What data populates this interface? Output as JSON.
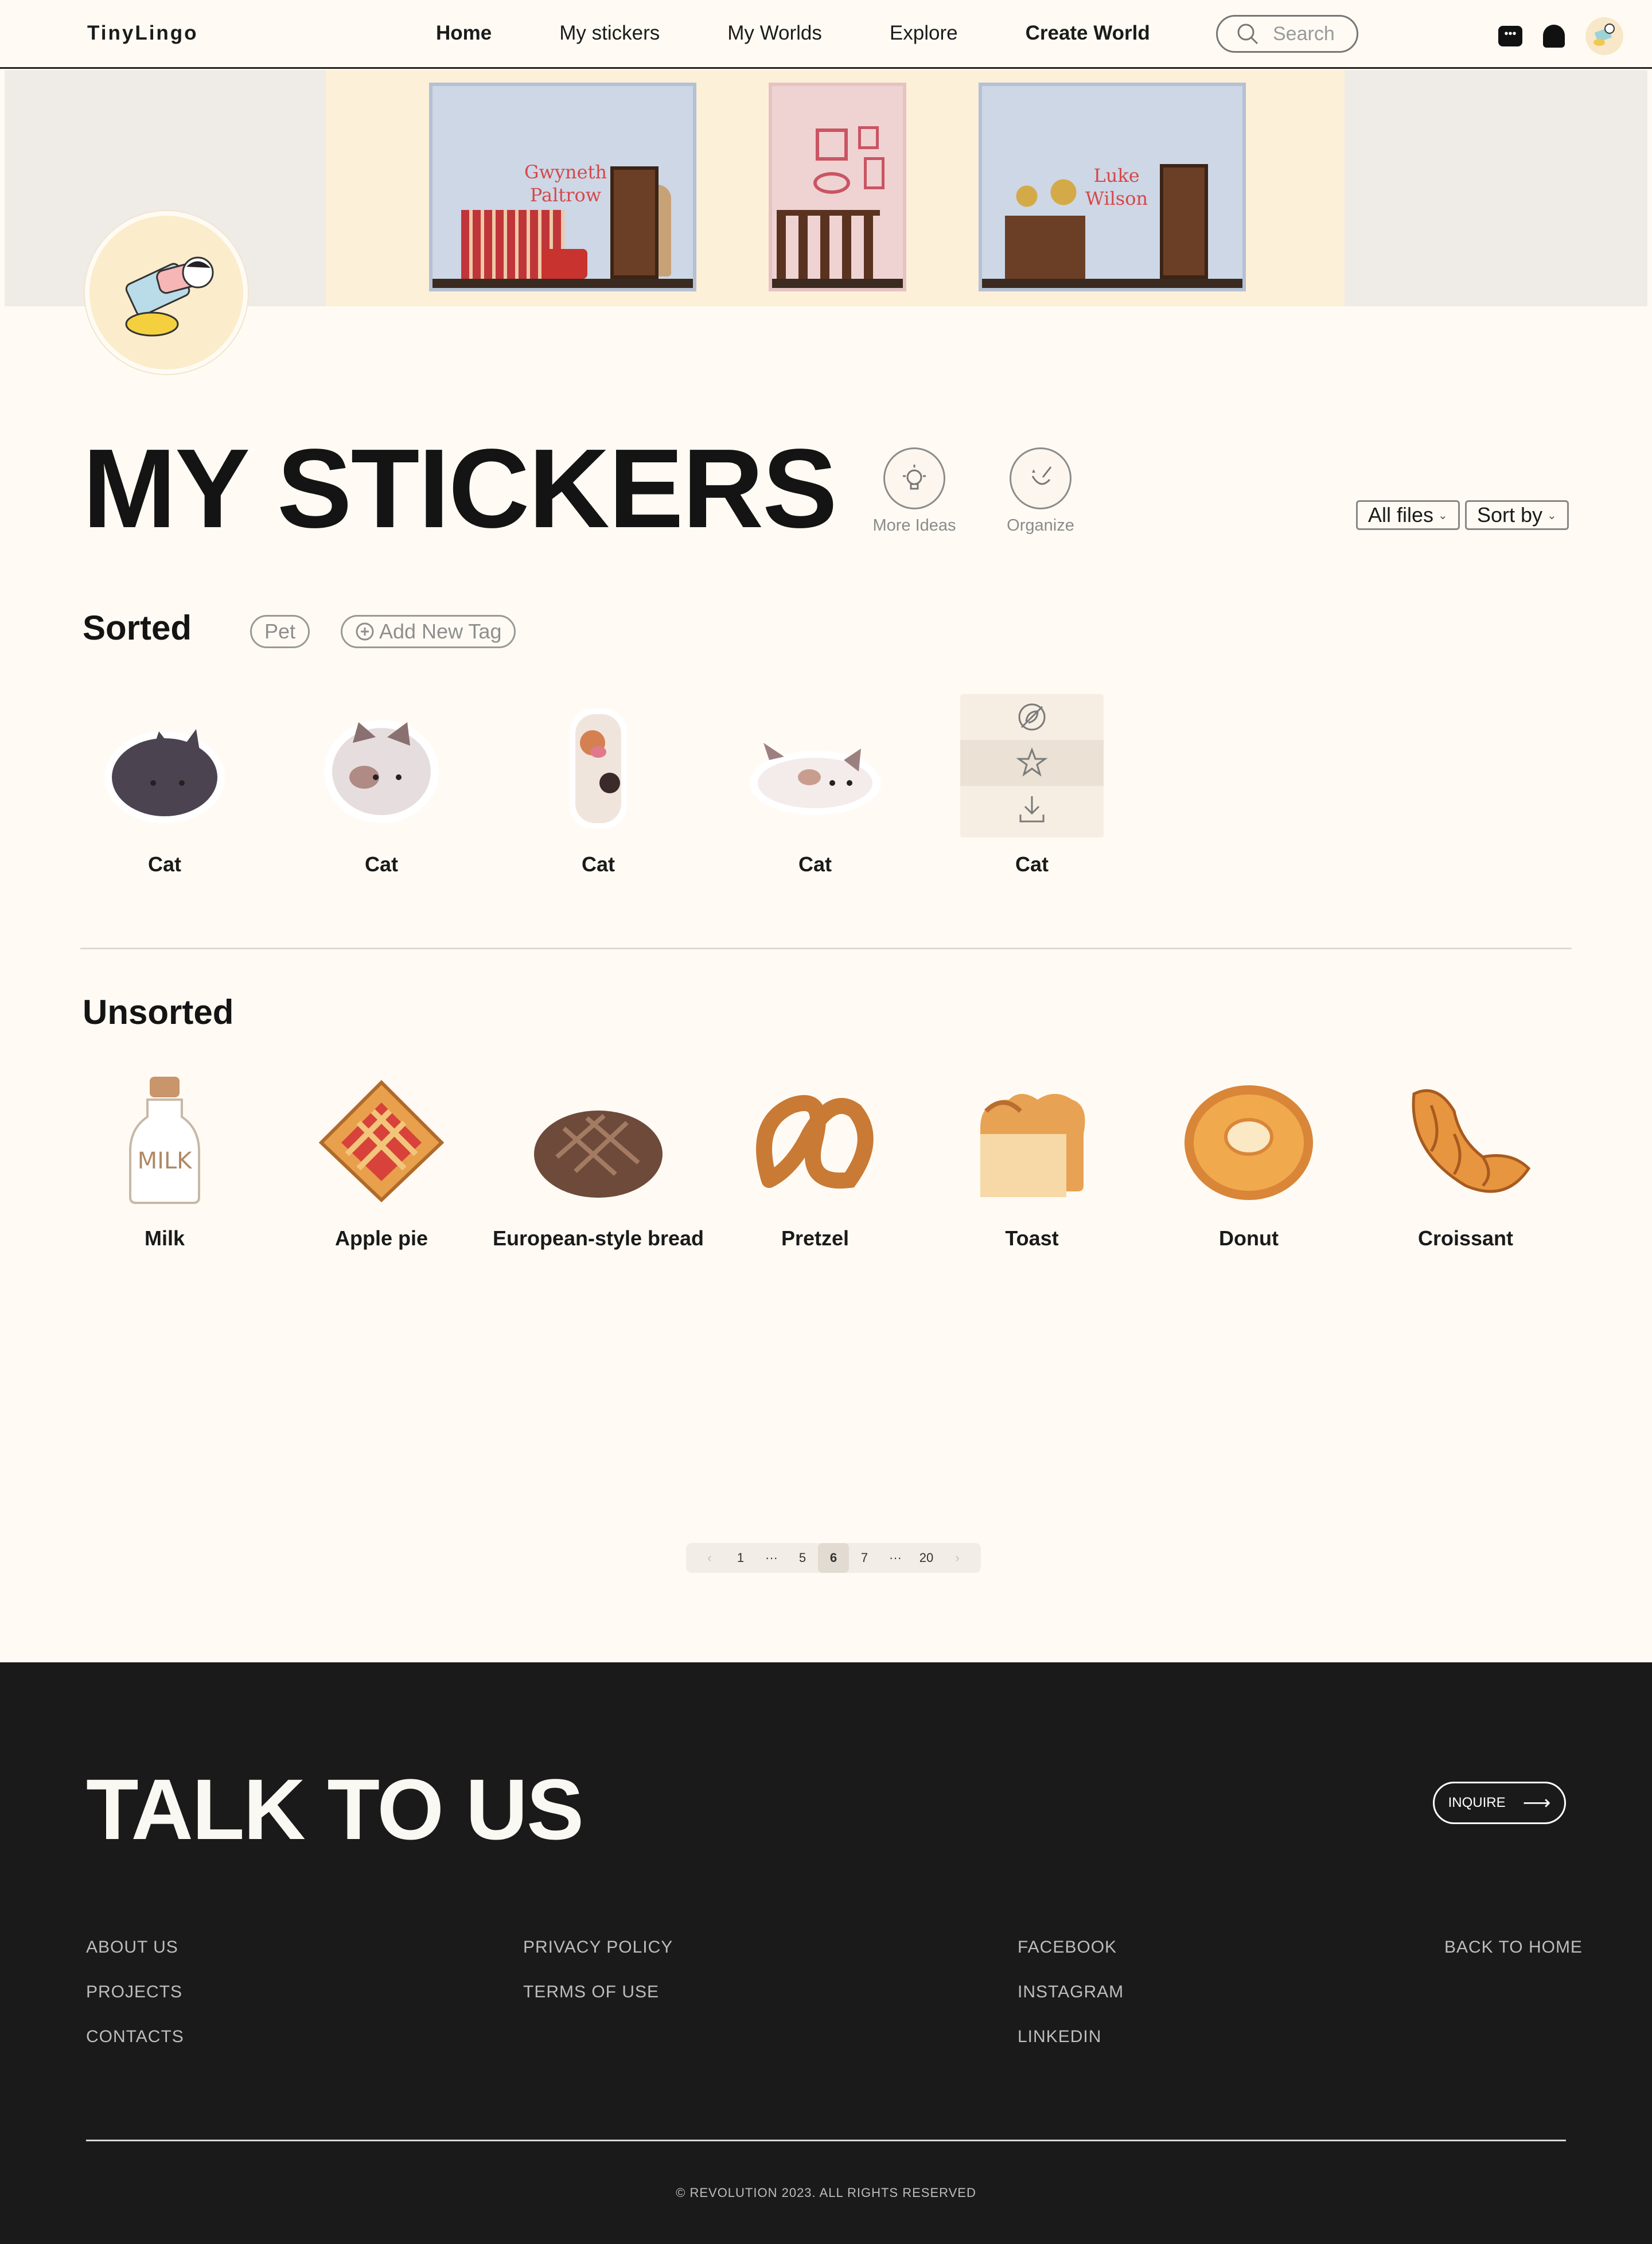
{
  "nav": {
    "logo": "TinyLingo",
    "links": [
      "Home",
      "My stickers",
      "My Worlds",
      "Explore",
      "Create World"
    ],
    "active": "Home",
    "search_placeholder": "Search"
  },
  "banner": {
    "rooms": [
      {
        "label_line1": "Gwyneth",
        "label_line2": "Paltrow"
      },
      {
        "label_line1": "",
        "label_line2": ""
      },
      {
        "label_line1": "Luke",
        "label_line2": "Wilson"
      }
    ]
  },
  "page_title": "MY STICKERS",
  "tools": {
    "more_ideas": "More Ideas",
    "organize": "Organize"
  },
  "filters": {
    "files": "All files",
    "sort": "Sort by"
  },
  "sorted": {
    "title": "Sorted",
    "tags": [
      "Pet"
    ],
    "add_tag": "Add New Tag",
    "items": [
      "Cat",
      "Cat",
      "Cat",
      "Cat",
      "Cat"
    ]
  },
  "unsorted": {
    "title": "Unsorted",
    "items": [
      "Milk",
      "Apple pie",
      "European-style bread",
      "Pretzel",
      "Toast",
      "Donut",
      "Croissant"
    ]
  },
  "pagination": {
    "prev": "‹",
    "pages": [
      "1",
      "···",
      "5",
      "6",
      "7",
      "···",
      "20"
    ],
    "current": "6",
    "next": "›"
  },
  "footer": {
    "title": "TALK TO US",
    "inquire": "INQUIRE",
    "col1": [
      "ABOUT US",
      "PROJECTS",
      "CONTACTS"
    ],
    "col2": [
      "PRIVACY POLICY",
      "TERMS OF USE"
    ],
    "col3": [
      "FACEBOOK",
      "INSTAGRAM",
      "LINKEDIN"
    ],
    "col4": [
      "BACK TO HOME"
    ],
    "copyright": "© REVOLUTION 2023. ALL RIGHTS RESERVED"
  }
}
